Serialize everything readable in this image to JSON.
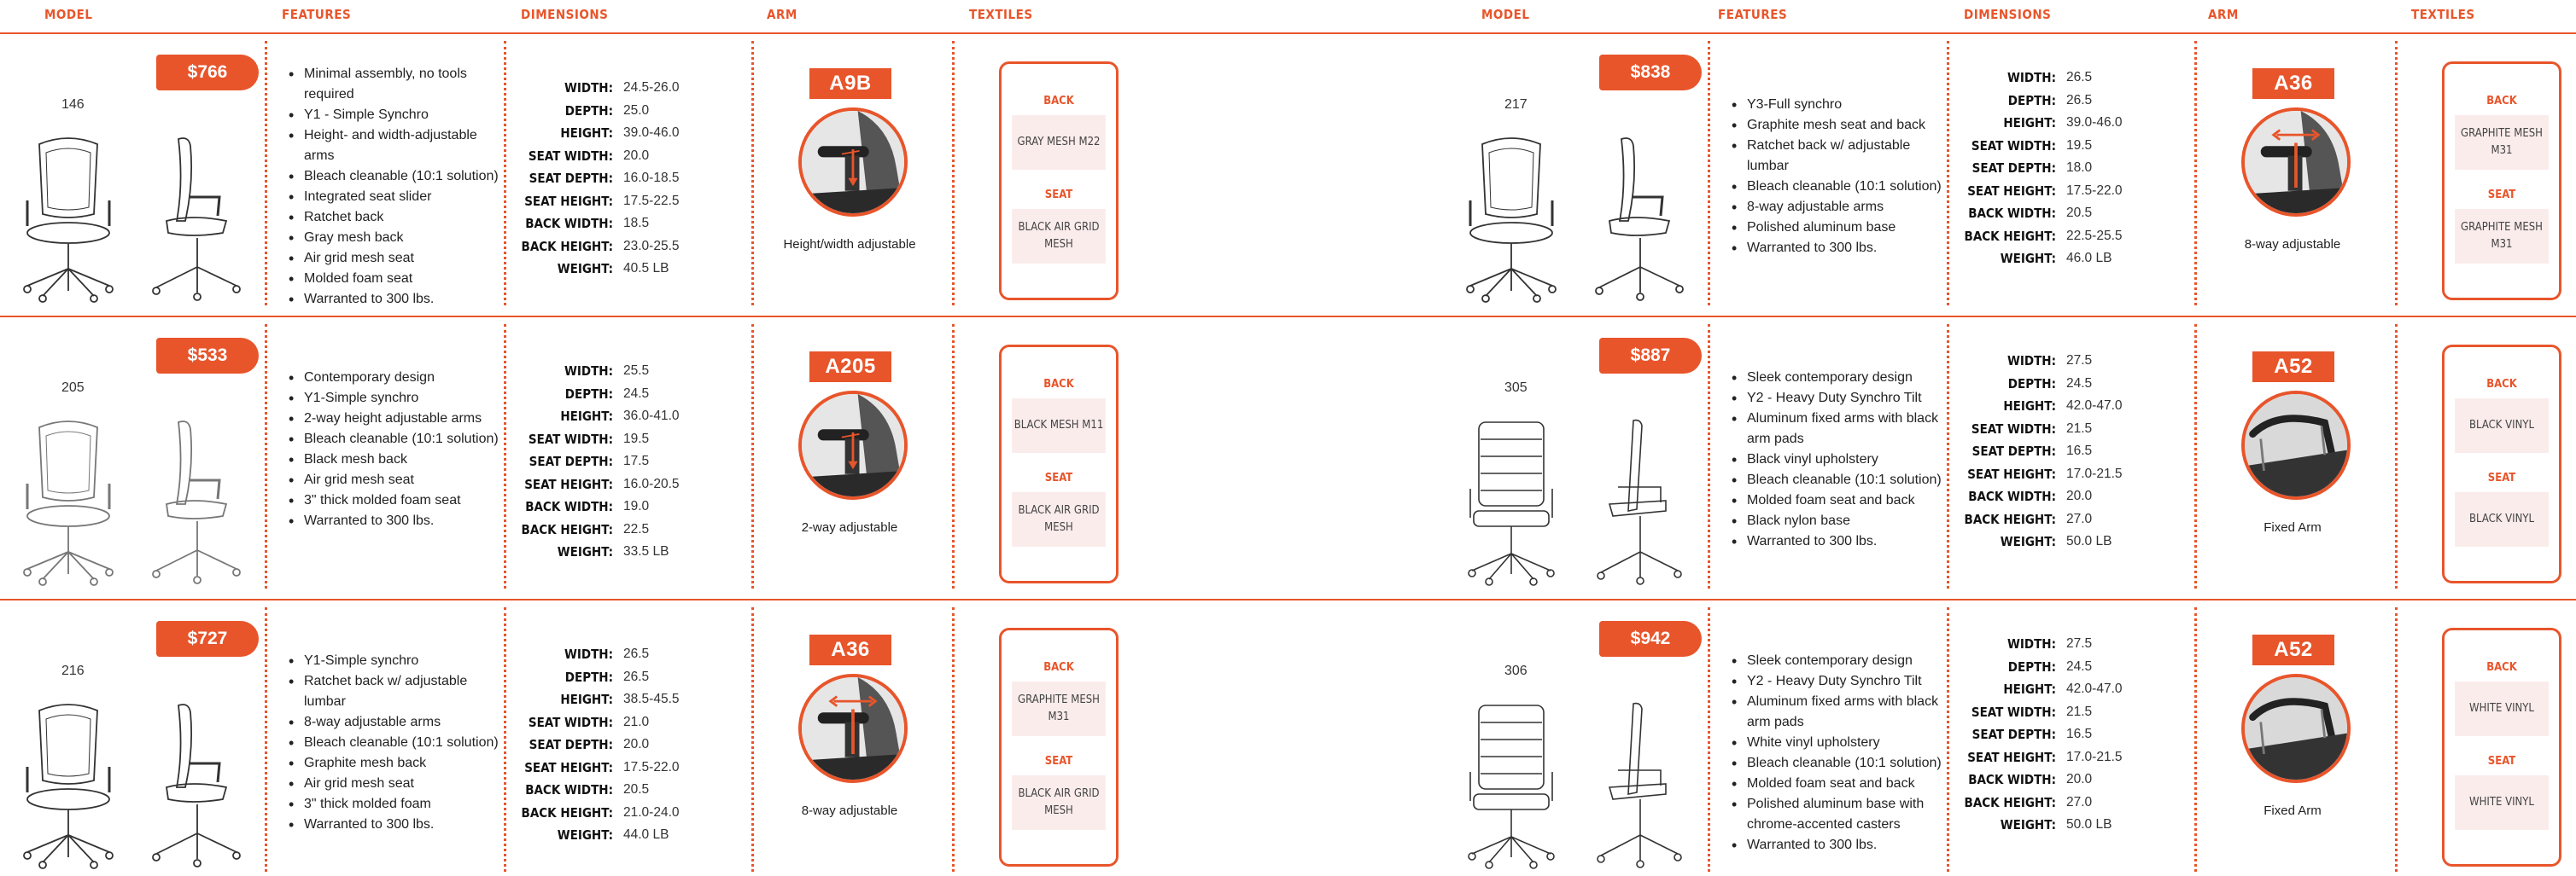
{
  "columns": [
    "MODEL",
    "FEATURES",
    "DIMENSIONS",
    "ARM",
    "TEXTILES"
  ],
  "dim_labels": [
    "WIDTH:",
    "DEPTH:",
    "HEIGHT:",
    "SEAT WIDTH:",
    "SEAT DEPTH:",
    "SEAT HEIGHT:",
    "BACK WIDTH:",
    "BACK HEIGHT:",
    "WEIGHT:"
  ],
  "textile_heads": {
    "back": "BACK",
    "seat": "SEAT"
  },
  "colors": {
    "accent": "#e8552b",
    "swatch": "#fbecec"
  },
  "products": [
    {
      "model": "146",
      "price": "$766",
      "chair_style": "mesh",
      "features": [
        "Minimal assembly, no tools required",
        "Y1 - Simple Synchro",
        "Height- and width-adjustable arms",
        "Bleach cleanable (10:1 solution)",
        "Integrated seat slider",
        "Ratchet back",
        "Gray mesh back",
        "Air grid mesh seat",
        "Molded foam seat",
        "Warranted to 300 lbs."
      ],
      "dims": [
        "24.5-26.0",
        "25.0",
        "39.0-46.0",
        "20.0",
        "16.0-18.5",
        "17.5-22.5",
        "18.5",
        "23.0-25.5",
        "40.5 LB"
      ],
      "arm": {
        "code": "A9B",
        "caption": "Height/width adjustable",
        "icon": "arm-adjust-vertical"
      },
      "textiles": {
        "back": "GRAY MESH M22",
        "seat": "BLACK AIR GRID MESH"
      }
    },
    {
      "model": "205",
      "price": "$533",
      "chair_style": "mesh-light",
      "features": [
        "Contemporary design",
        "Y1-Simple synchro",
        "2-way height adjustable arms",
        "Bleach cleanable (10:1 solution)",
        "Black mesh back",
        "Air grid mesh seat",
        "3\" thick molded foam seat",
        "Warranted to 300 lbs."
      ],
      "dims": [
        "25.5",
        "24.5",
        "36.0-41.0",
        "19.5",
        "17.5",
        "16.0-20.5",
        "19.0",
        "22.5",
        "33.5 LB"
      ],
      "arm": {
        "code": "A205",
        "caption": "2-way adjustable",
        "icon": "arm-adjust-vertical"
      },
      "textiles": {
        "back": "BLACK MESH M11",
        "seat": "BLACK AIR GRID MESH"
      }
    },
    {
      "model": "216",
      "price": "$727",
      "chair_style": "mesh",
      "features": [
        "Y1-Simple synchro",
        "Ratchet back w/ adjustable lumbar",
        "8-way adjustable arms",
        "Bleach cleanable (10:1 solution)",
        "Graphite mesh back",
        "Air grid mesh seat",
        "3\" thick molded foam",
        "Warranted to 300 lbs."
      ],
      "dims": [
        "26.5",
        "26.5",
        "38.5-45.5",
        "21.0",
        "20.0",
        "17.5-22.0",
        "20.5",
        "21.0-24.0",
        "44.0 LB"
      ],
      "arm": {
        "code": "A36",
        "caption": "8-way adjustable",
        "icon": "arm-adjust-multi"
      },
      "textiles": {
        "back": "GRAPHITE MESH M31",
        "seat": "BLACK AIR GRID MESH"
      }
    },
    {
      "model": "217",
      "price": "$838",
      "chair_style": "mesh",
      "features": [
        "Y3-Full synchro",
        "Graphite mesh seat and back",
        "Ratchet back w/ adjustable lumbar",
        "Bleach cleanable (10:1 solution)",
        "8-way adjustable arms",
        "Polished aluminum base",
        "Warranted to 300 lbs."
      ],
      "dims": [
        "26.5",
        "26.5",
        "39.0-46.0",
        "19.5",
        "18.0",
        "17.5-22.0",
        "20.5",
        "22.5-25.5",
        "46.0 LB"
      ],
      "arm": {
        "code": "A36",
        "caption": "8-way adjustable",
        "icon": "arm-adjust-multi"
      },
      "textiles": {
        "back": "GRAPHITE MESH M31",
        "seat": "GRAPHITE MESH M31"
      }
    },
    {
      "model": "305",
      "price": "$887",
      "chair_style": "executive",
      "features": [
        "Sleek contemporary design",
        "Y2 - Heavy Duty Synchro Tilt",
        "Aluminum fixed arms with black arm pads",
        "Black vinyl upholstery",
        "Bleach cleanable (10:1 solution)",
        "Molded foam seat and back",
        "Black nylon base",
        "Warranted to 300 lbs."
      ],
      "dims": [
        "27.5",
        "24.5",
        "42.0-47.0",
        "21.5",
        "16.5",
        "17.0-21.5",
        "20.0",
        "27.0",
        "50.0 LB"
      ],
      "arm": {
        "code": "A52",
        "caption": "Fixed Arm",
        "icon": "arm-fixed"
      },
      "textiles": {
        "back": "BLACK VINYL",
        "seat": "BLACK VINYL"
      }
    },
    {
      "model": "306",
      "price": "$942",
      "chair_style": "executive",
      "features": [
        "Sleek contemporary design",
        "Y2 - Heavy Duty Synchro Tilt",
        "Aluminum fixed arms with black arm pads",
        "White vinyl upholstery",
        "Bleach cleanable (10:1 solution)",
        "Molded foam seat and back",
        "Polished aluminum base with chrome-accented casters",
        "Warranted to 300 lbs."
      ],
      "dims": [
        "27.5",
        "24.5",
        "42.0-47.0",
        "21.5",
        "16.5",
        "17.0-21.5",
        "20.0",
        "27.0",
        "50.0 LB"
      ],
      "arm": {
        "code": "A52",
        "caption": "Fixed Arm",
        "icon": "arm-fixed"
      },
      "textiles": {
        "back": "WHITE VINYL",
        "seat": "WHITE VINYL"
      }
    }
  ]
}
